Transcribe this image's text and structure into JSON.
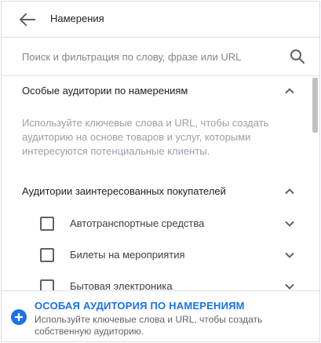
{
  "header": {
    "back_icon": "arrow-back-icon",
    "title": "Намерения"
  },
  "search": {
    "placeholder": "Поиск и фильтрация по слову, фразе или URL",
    "value": "",
    "icon": "search-icon"
  },
  "sections": {
    "custom": {
      "label": "Особые аудитории по намерениям",
      "expanded": true,
      "description": "Используйте ключевые слова и URL, чтобы создать аудиторию на основе товаров и услуг, которыми интересуются потенциальные клиенты."
    },
    "in_market": {
      "label": "Аудитории заинтересованных покупателей",
      "expanded": true,
      "items": [
        {
          "label": "Автотранспортные средства",
          "checked": false
        },
        {
          "label": "Билеты на мероприятия",
          "checked": false
        },
        {
          "label": "Бытовая электроника",
          "checked": false
        }
      ]
    }
  },
  "footer": {
    "icon": "add-circle-icon",
    "title": "ОСОБАЯ АУДИТОРИЯ ПО НАМЕРЕНИЯМ",
    "text": "Используйте ключевые слова и URL, чтобы создать собственную аудиторию."
  },
  "colors": {
    "accent": "#1a73e8",
    "text_primary": "#202124",
    "text_secondary": "#5f6368",
    "text_muted": "#9aa0a6",
    "divider": "#e0e0e0"
  }
}
